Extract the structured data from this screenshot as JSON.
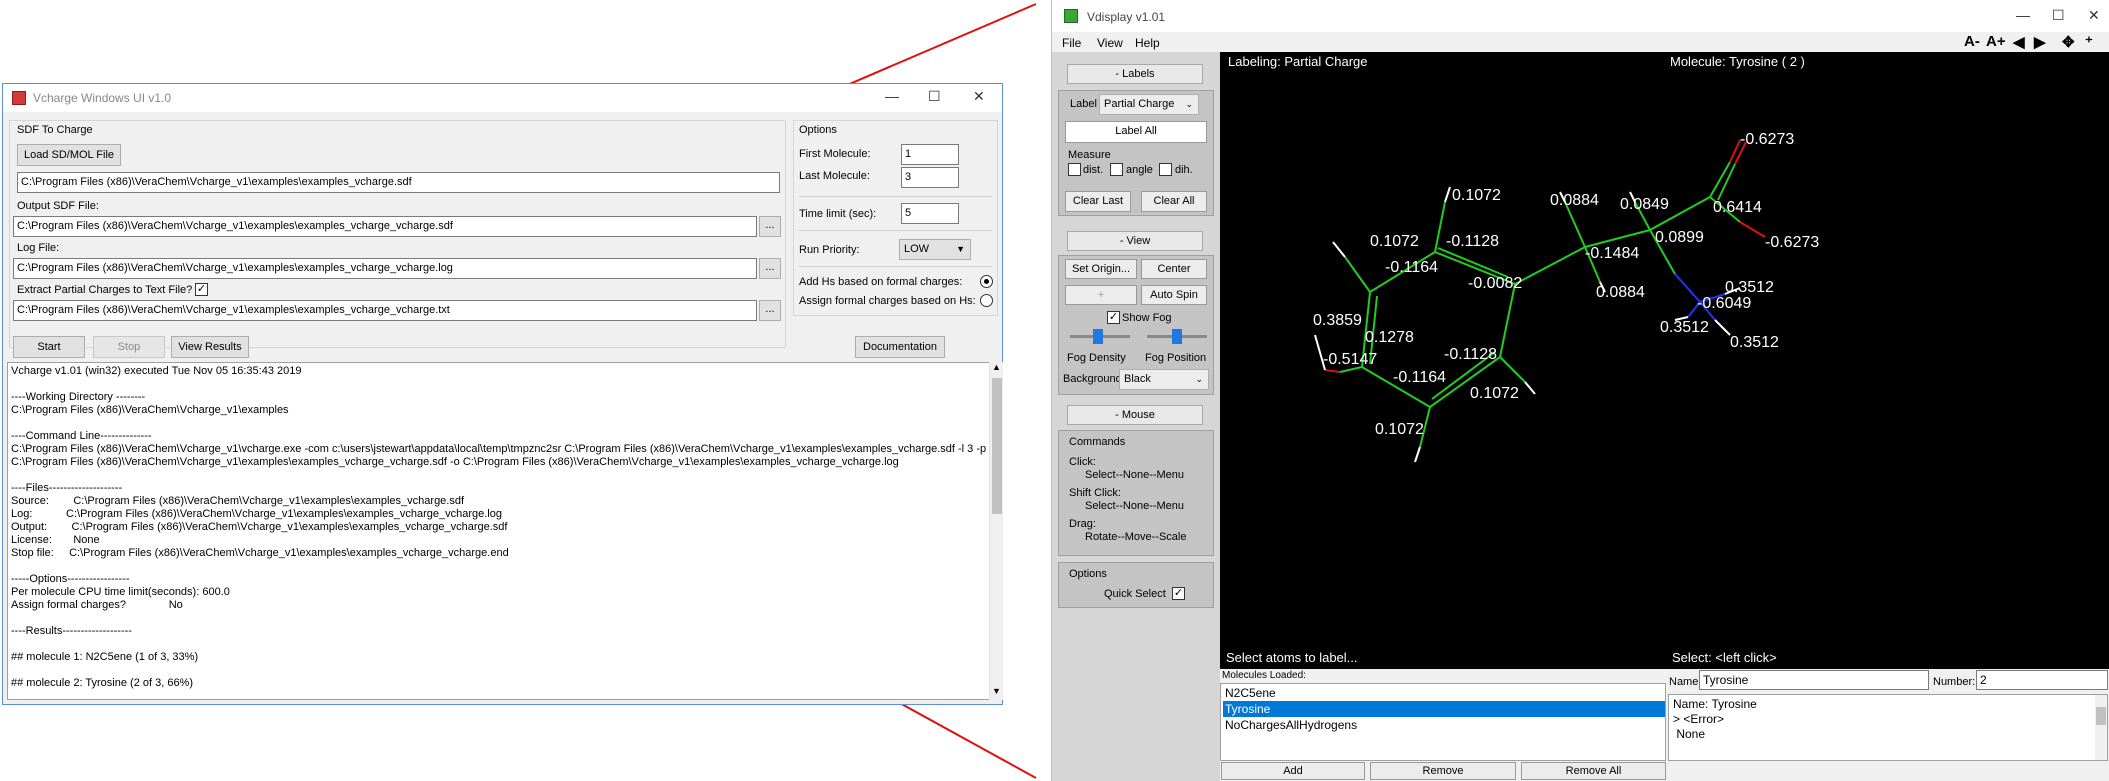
{
  "vcharge": {
    "title": "Vcharge Windows UI v1.0",
    "sdf_group": "SDF To Charge",
    "load_button": "Load SD/MOL File",
    "sdf_path": "C:\\Program Files (x86)\\VeraChem\\Vcharge_v1\\examples\\examples_vcharge.sdf",
    "output_label": "Output SDF File:",
    "output_path": "C:\\Program Files (x86)\\VeraChem\\Vcharge_v1\\examples\\examples_vcharge_vcharge.sdf",
    "log_label": "Log File:",
    "log_path": "C:\\Program Files (x86)\\VeraChem\\Vcharge_v1\\examples\\examples_vcharge_vcharge.log",
    "extract_label": "Extract Partial Charges to Text File?",
    "extract_checked": "✓",
    "txt_path": "C:\\Program Files (x86)\\VeraChem\\Vcharge_v1\\examples\\examples_vcharge_vcharge.txt",
    "ellipsis": "...",
    "options_group": "Options",
    "first_molecule_label": "First Molecule:",
    "first_molecule": "1",
    "last_molecule_label": "Last Molecule:",
    "last_molecule": "3",
    "time_limit_label": "Time limit (sec):",
    "time_limit": "5",
    "priority_label": "Run Priority:",
    "priority": "LOW",
    "add_hs_label": "Add Hs based on formal charges:",
    "assign_formal_label": "Assign formal charges based on Hs:",
    "start_button": "Start",
    "stop_button": "Stop",
    "view_results_button": "View Results",
    "documentation_button": "Documentation",
    "log_lines": [
      "Vcharge v1.01 (win32) executed Tue Nov 05 16:35:43 2019",
      "",
      "----Working Directory --------",
      "C:\\Program Files (x86)\\VeraChem\\Vcharge_v1\\examples",
      "",
      "----Command Line--------------",
      "C:\\Program Files (x86)\\VeraChem\\Vcharge_v1\\vcharge.exe -com c:\\users\\jstewart\\appdata\\local\\temp\\tmpznc2sr C:\\Program Files (x86)\\VeraChem\\Vcharge_v1\\examples\\examples_vcharge.sdf -l 3 -p",
      "C:\\Program Files (x86)\\VeraChem\\Vcharge_v1\\examples\\examples_vcharge_vcharge.sdf -o C:\\Program Files (x86)\\VeraChem\\Vcharge_v1\\examples\\examples_vcharge_vcharge.log",
      "",
      "----Files--------------------",
      "Source:        C:\\Program Files (x86)\\VeraChem\\Vcharge_v1\\examples\\examples_vcharge.sdf",
      "Log:           C:\\Program Files (x86)\\VeraChem\\Vcharge_v1\\examples\\examples_vcharge_vcharge.log",
      "Output:        C:\\Program Files (x86)\\VeraChem\\Vcharge_v1\\examples\\examples_vcharge_vcharge.sdf",
      "License:       None",
      "Stop file:     C:\\Program Files (x86)\\VeraChem\\Vcharge_v1\\examples\\examples_vcharge_vcharge.end",
      "",
      "-----Options-----------------",
      "Per molecule CPU time limit(seconds): 600.0",
      "Assign formal charges?              No",
      "",
      "----Results-------------------",
      "",
      "## molecule 1: N2C5ene (1 of 3, 33%)",
      "",
      "## molecule 2: Tyrosine (2 of 3, 66%)"
    ]
  },
  "vdisplay": {
    "title": "Vdisplay v1.01",
    "menu": [
      "File",
      "View",
      "Help"
    ],
    "toolbar": [
      "A-",
      "A+",
      "◀",
      "▶",
      "✥",
      "⁺"
    ],
    "labels_head": "- Labels",
    "label_text": "Label",
    "label_mode": "Partial Charge",
    "label_all": "Label All",
    "measure": "Measure",
    "dist": "dist.",
    "angle": "angle",
    "dih": "dih.",
    "clear_last": "Clear Last",
    "clear_all": "Clear All",
    "view_head": "- View",
    "set_origin": "Set Origin...",
    "center": "Center",
    "plus": "+",
    "auto_spin": "Auto Spin",
    "show_fog": "Show Fog",
    "fog_density": "Fog Density",
    "fog_position": "Fog Position",
    "background_label": "Background",
    "background": "Black",
    "mouse_head": "- Mouse",
    "commands": "Commands",
    "click": "Click:",
    "click_action": "Select--None--Menu",
    "shift_click": "Shift Click:",
    "shift_action": "Select--None--Menu",
    "drag": "Drag:",
    "drag_action": "Rotate--Move--Scale",
    "options": "Options",
    "quick_select": "Quick Select",
    "labeling": "Labeling: Partial Charge",
    "molecule": "Molecule: Tyrosine ( 2 )",
    "select_atoms": "Select atoms to label...",
    "select_hint": "Select: <left click>",
    "molecules_loaded": "Molecules Loaded:",
    "molecules": [
      "N2C5ene",
      "Tyrosine",
      "NoChargesAllHydrogens"
    ],
    "name_label": "Name:",
    "name_value": "Tyrosine",
    "number_label": "Number:",
    "number_value": "2",
    "info_lines": [
      "Name: Tyrosine",
      "> <Error>",
      " None"
    ],
    "add": "Add",
    "remove": "Remove",
    "remove_all": "Remove All",
    "atom_labels": [
      "-0.6273",
      "0.6414",
      "-0.6273",
      "0.0849",
      "0.0899",
      "0.0884",
      "-0.1484",
      "0.0884",
      "0.1072",
      "-0.1128",
      "0.1072",
      "-0.1164",
      "-0.0082",
      "0.3512",
      "-0.6049",
      "0.3512",
      "0.3512",
      "0.3859",
      "0.1278",
      "-0.5147",
      "-0.1128",
      "-0.1164",
      "0.1072",
      "0.1072"
    ]
  }
}
